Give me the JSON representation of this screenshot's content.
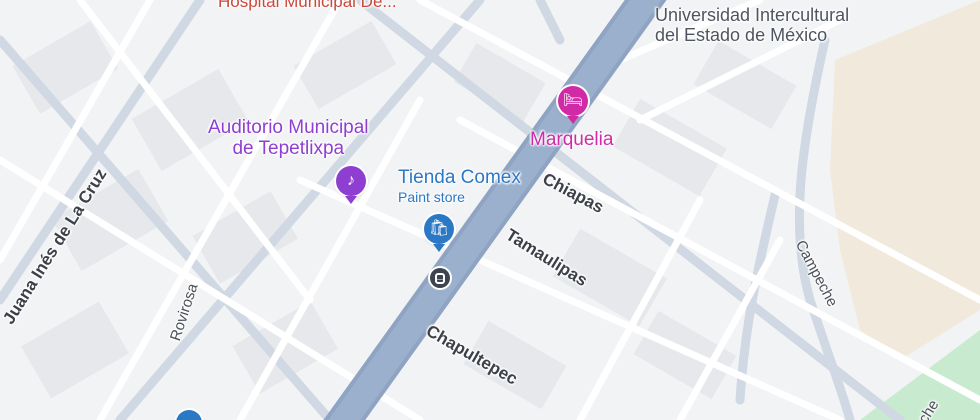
{
  "colors": {
    "background": "#f2f3f5",
    "block": "#e6e8ec",
    "highway": "#8fa3c2",
    "minor_road": "#ffffff",
    "secondary_road": "#cfd8e3",
    "sand": "#f1e9db",
    "park": "#c8ebd0",
    "poi_purple": "#8e3fd1",
    "poi_blue": "#2b78c5",
    "poi_pink": "#d12aa6",
    "poi_red": "#c9483b"
  },
  "places": {
    "hospital": "Hospital Municipal De...",
    "university_line1": "Universidad Intercultural",
    "university_line2": "del Estado de México",
    "auditorio_line1": "Auditorio Municipal",
    "auditorio_line2": "de Tepetlixpa",
    "tienda_name": "Tienda Comex",
    "tienda_category": "Paint store",
    "hotel": "Marquelia"
  },
  "streets": {
    "juana": "Juana Inés de La Cruz",
    "chiapas": "Chiapas",
    "tamaulipas": "Tamaulipas",
    "chapultepec": "Chapultepec",
    "rovirosa": "Rovirosa",
    "campeche": "Campeche",
    "campeche_partial": "che"
  },
  "icons": {
    "auditorio": "music-note-icon",
    "tienda": "shopping-bag-icon",
    "hotel": "bed-icon",
    "transit": "bus-stop-icon",
    "partial_pin": "map-pin-icon"
  }
}
